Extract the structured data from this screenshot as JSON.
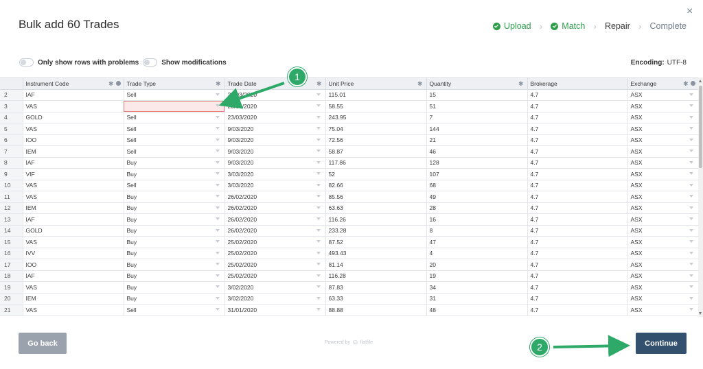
{
  "header": {
    "title": "Bulk add 60 Trades",
    "close_label": "×",
    "steps": [
      {
        "label": "Upload",
        "state": "done"
      },
      {
        "label": "Match",
        "state": "done"
      },
      {
        "label": "Repair",
        "state": "current"
      },
      {
        "label": "Complete",
        "state": "todo"
      }
    ]
  },
  "toolbar": {
    "problems_label": "Only show rows with problems",
    "modifications_label": "Show modifications",
    "encoding_label": "Encoding:",
    "encoding_value": "UTF-8"
  },
  "grid": {
    "columns": [
      "Instrument Code",
      "Trade Type",
      "Trade Date",
      "Unit Price",
      "Quantity",
      "Brokerage",
      "Exchange"
    ],
    "rows": [
      {
        "n": "2",
        "cells": [
          "IAF",
          "Sell",
          "23/03/2020",
          "115.01",
          "15",
          "4.7",
          "ASX"
        ]
      },
      {
        "n": "3",
        "cells": [
          "VAS",
          "",
          "23/03/2020",
          "58.55",
          "51",
          "4.7",
          "ASX"
        ]
      },
      {
        "n": "4",
        "cells": [
          "GOLD",
          "Sell",
          "23/03/2020",
          "243.95",
          "7",
          "4.7",
          "ASX"
        ]
      },
      {
        "n": "5",
        "cells": [
          "VAS",
          "Sell",
          "9/03/2020",
          "75.04",
          "144",
          "4.7",
          "ASX"
        ]
      },
      {
        "n": "6",
        "cells": [
          "IOO",
          "Sell",
          "9/03/2020",
          "72.56",
          "21",
          "4.7",
          "ASX"
        ]
      },
      {
        "n": "7",
        "cells": [
          "IEM",
          "Sell",
          "9/03/2020",
          "58.87",
          "46",
          "4.7",
          "ASX"
        ]
      },
      {
        "n": "8",
        "cells": [
          "IAF",
          "Buy",
          "9/03/2020",
          "117.86",
          "128",
          "4.7",
          "ASX"
        ]
      },
      {
        "n": "9",
        "cells": [
          "VIF",
          "Buy",
          "3/03/2020",
          "52",
          "107",
          "4.7",
          "ASX"
        ]
      },
      {
        "n": "10",
        "cells": [
          "VAS",
          "Sell",
          "3/03/2020",
          "82.66",
          "68",
          "4.7",
          "ASX"
        ]
      },
      {
        "n": "11",
        "cells": [
          "VAS",
          "Buy",
          "26/02/2020",
          "85.56",
          "49",
          "4.7",
          "ASX"
        ]
      },
      {
        "n": "12",
        "cells": [
          "IEM",
          "Buy",
          "26/02/2020",
          "63.63",
          "28",
          "4.7",
          "ASX"
        ]
      },
      {
        "n": "13",
        "cells": [
          "IAF",
          "Buy",
          "26/02/2020",
          "116.26",
          "16",
          "4.7",
          "ASX"
        ]
      },
      {
        "n": "14",
        "cells": [
          "GOLD",
          "Buy",
          "26/02/2020",
          "233.28",
          "8",
          "4.7",
          "ASX"
        ]
      },
      {
        "n": "15",
        "cells": [
          "VAS",
          "Buy",
          "25/02/2020",
          "87.52",
          "47",
          "4.7",
          "ASX"
        ]
      },
      {
        "n": "16",
        "cells": [
          "IVV",
          "Buy",
          "25/02/2020",
          "493.43",
          "4",
          "4.7",
          "ASX"
        ]
      },
      {
        "n": "17",
        "cells": [
          "IOO",
          "Buy",
          "25/02/2020",
          "81.14",
          "20",
          "4.7",
          "ASX"
        ]
      },
      {
        "n": "18",
        "cells": [
          "IAF",
          "Buy",
          "25/02/2020",
          "116.28",
          "19",
          "4.7",
          "ASX"
        ]
      },
      {
        "n": "19",
        "cells": [
          "VAS",
          "Buy",
          "3/02/2020",
          "87.83",
          "34",
          "4.7",
          "ASX"
        ]
      },
      {
        "n": "20",
        "cells": [
          "IEM",
          "Buy",
          "3/02/2020",
          "63.33",
          "31",
          "4.7",
          "ASX"
        ]
      },
      {
        "n": "21",
        "cells": [
          "VAS",
          "Sell",
          "31/01/2020",
          "88.88",
          "48",
          "4.7",
          "ASX"
        ]
      }
    ]
  },
  "footer": {
    "back_label": "Go back",
    "continue_label": "Continue",
    "powered_label": "Powered by",
    "powered_brand": "flatfile"
  },
  "callouts": {
    "one": "1",
    "two": "2"
  },
  "colors": {
    "accent_green": "#2ea968",
    "continue_bg": "#33506e",
    "error_bg": "#fbe9e9"
  }
}
